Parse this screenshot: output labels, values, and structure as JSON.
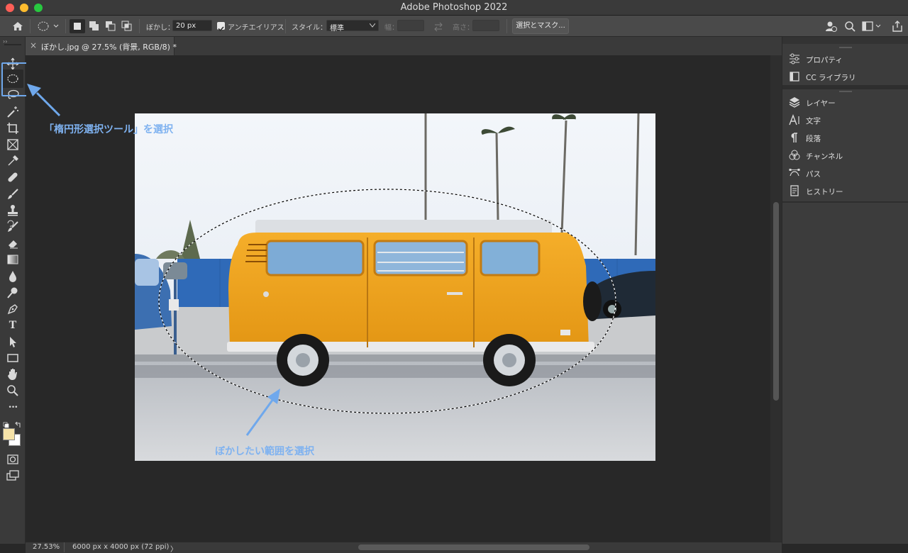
{
  "window": {
    "title": "Adobe Photoshop 2022",
    "traffic_colors": [
      "#fe5f57",
      "#febc2e",
      "#28c840"
    ]
  },
  "options_bar": {
    "feather_label": "ぼかし：",
    "feather_value": "20 px",
    "antialias_label": "アンチエイリアス",
    "antialias_checked": true,
    "style_label": "スタイル：",
    "style_value": "標準",
    "width_label": "幅：",
    "height_label": "高さ：",
    "select_mask_button": "選択とマスク..."
  },
  "document_tab": {
    "label": "ぼかし.jpg @ 27.5% (背景, RGB/8) *",
    "close_glyph": "×"
  },
  "toolbar": {
    "tools": [
      "move-tool",
      "elliptical-marquee-tool",
      "lasso-tool",
      "magic-wand-tool",
      "crop-tool",
      "frame-tool",
      "eyedropper-tool",
      "healing-brush-tool",
      "brush-tool",
      "clone-stamp-tool",
      "history-brush-tool",
      "eraser-tool",
      "gradient-tool",
      "blur-tool",
      "dodge-tool",
      "pen-tool",
      "type-tool",
      "path-selection-tool",
      "rectangle-tool",
      "hand-tool",
      "zoom-tool",
      "more-tools",
      "color-swatches",
      "quick-mask",
      "screen-mode"
    ],
    "type_glyph": "T",
    "more_glyph": "•••",
    "foreground_color": "#f6e3a8",
    "background_color": "#ffffff"
  },
  "right_panel": {
    "group1": [
      {
        "label": "プロパティ",
        "icon": "sliders-icon"
      },
      {
        "label": "CC ライブラリ",
        "icon": "library-icon"
      }
    ],
    "group2": [
      {
        "label": "レイヤー",
        "icon": "layers-icon"
      },
      {
        "label": "文字",
        "icon": "character-icon"
      },
      {
        "label": "段落",
        "icon": "paragraph-icon"
      },
      {
        "label": "チャンネル",
        "icon": "channels-icon"
      },
      {
        "label": "パス",
        "icon": "paths-icon"
      },
      {
        "label": "ヒストリー",
        "icon": "history-icon"
      }
    ]
  },
  "status_bar": {
    "zoom": "27.53%",
    "doc_size": "6000 px x 4000 px (72 ppi)",
    "arrow": "〉"
  },
  "annotations": {
    "tool_callout": "「楕円形選択ツール」を選択",
    "area_callout": "ぼかしたい範囲を選択",
    "color": "#7fb2f0"
  },
  "photo": {
    "subject": "orange camper van",
    "van_color": "#f0a51c"
  }
}
